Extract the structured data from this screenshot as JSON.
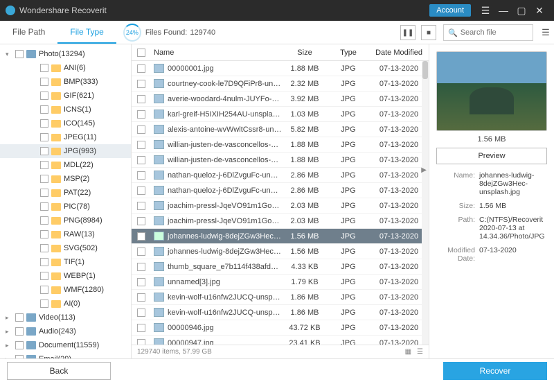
{
  "titlebar": {
    "appname": "Wondershare Recoverit",
    "account": "Account"
  },
  "tabs": {
    "path": "File Path",
    "type": "File Type"
  },
  "scan": {
    "percent": "24%",
    "label": "Files Found:",
    "count": "129740"
  },
  "search": {
    "placeholder": "Search file"
  },
  "columns": {
    "name": "Name",
    "size": "Size",
    "type": "Type",
    "date": "Date Modified"
  },
  "tree": {
    "root": {
      "label": "Photo(13294)"
    },
    "children": [
      "ANI(6)",
      "BMP(333)",
      "GIF(621)",
      "ICNS(1)",
      "ICO(145)",
      "JPEG(11)",
      "JPG(993)",
      "MDL(22)",
      "MSP(2)",
      "PAT(22)",
      "PIC(78)",
      "PNG(8984)",
      "RAW(13)",
      "SVG(502)",
      "TIF(1)",
      "WEBP(1)",
      "WMF(1280)",
      "AI(0)"
    ],
    "siblings": [
      "Video(113)",
      "Audio(243)",
      "Document(11559)",
      "Email(29)"
    ]
  },
  "rows": [
    {
      "name": "00000001.jpg",
      "size": "1.88 MB",
      "type": "JPG",
      "date": "07-13-2020"
    },
    {
      "name": "courtney-cook-le7D9QFiPr8-unsplash...",
      "size": "2.32 MB",
      "type": "JPG",
      "date": "07-13-2020"
    },
    {
      "name": "averie-woodard-4nulm-JUYFo-unspla...",
      "size": "3.92 MB",
      "type": "JPG",
      "date": "07-13-2020"
    },
    {
      "name": "karl-greif-H5IXIH254AU-unsplash.jpg",
      "size": "1.03 MB",
      "type": "JPG",
      "date": "07-13-2020"
    },
    {
      "name": "alexis-antoine-wvWwltCssr8-unsplas...",
      "size": "5.82 MB",
      "type": "JPG",
      "date": "07-13-2020"
    },
    {
      "name": "willian-justen-de-vasconcellos-65Ga...",
      "size": "1.88 MB",
      "type": "JPG",
      "date": "07-13-2020"
    },
    {
      "name": "willian-justen-de-vasconcellos-65Ga...",
      "size": "1.88 MB",
      "type": "JPG",
      "date": "07-13-2020"
    },
    {
      "name": "nathan-queloz-j-6DlZvguFc-unsplash...",
      "size": "2.86 MB",
      "type": "JPG",
      "date": "07-13-2020"
    },
    {
      "name": "nathan-queloz-j-6DlZvguFc-unsplash...",
      "size": "2.86 MB",
      "type": "JPG",
      "date": "07-13-2020"
    },
    {
      "name": "joachim-pressl-JqeVO91m1Go-unspl...",
      "size": "2.03 MB",
      "type": "JPG",
      "date": "07-13-2020"
    },
    {
      "name": "joachim-pressl-JqeVO91m1Go-unspl...",
      "size": "2.03 MB",
      "type": "JPG",
      "date": "07-13-2020"
    },
    {
      "name": "johannes-ludwig-8dejZGw3Hec-unsp...",
      "size": "1.56 MB",
      "type": "JPG",
      "date": "07-13-2020",
      "selected": true
    },
    {
      "name": "johannes-ludwig-8dejZGw3Hec-unsp...",
      "size": "1.56 MB",
      "type": "JPG",
      "date": "07-13-2020"
    },
    {
      "name": "thumb_square_e7b114f438afdd40e0...",
      "size": "4.33 KB",
      "type": "JPG",
      "date": "07-13-2020"
    },
    {
      "name": "unnamed[3].jpg",
      "size": "1.79 KB",
      "type": "JPG",
      "date": "07-13-2020"
    },
    {
      "name": "kevin-wolf-u16nfw2JUCQ-unsplash.jpg",
      "size": "1.86 MB",
      "type": "JPG",
      "date": "07-13-2020"
    },
    {
      "name": "kevin-wolf-u16nfw2JUCQ-unsplash.jpg",
      "size": "1.86 MB",
      "type": "JPG",
      "date": "07-13-2020"
    },
    {
      "name": "00000946.jpg",
      "size": "43.72 KB",
      "type": "JPG",
      "date": "07-13-2020"
    },
    {
      "name": "00000947.jpg",
      "size": "23.41 KB",
      "type": "JPG",
      "date": "07-13-2020"
    }
  ],
  "footer": {
    "summary": "129740 items, 57.99 GB"
  },
  "preview": {
    "sizeShort": "1.56 MB",
    "btn": "Preview",
    "name_k": "Name:",
    "name_v": "johannes-ludwig-8dejZGw3Hec-unsplash.jpg",
    "size_k": "Size:",
    "size_v": "1.56 MB",
    "path_k": "Path:",
    "path_v": "C:(NTFS)/Recoverit 2020-07-13 at 14.34.36/Photo/JPG",
    "date_k": "Modified Date:",
    "date_v": "07-13-2020"
  },
  "buttons": {
    "back": "Back",
    "recover": "Recover"
  }
}
